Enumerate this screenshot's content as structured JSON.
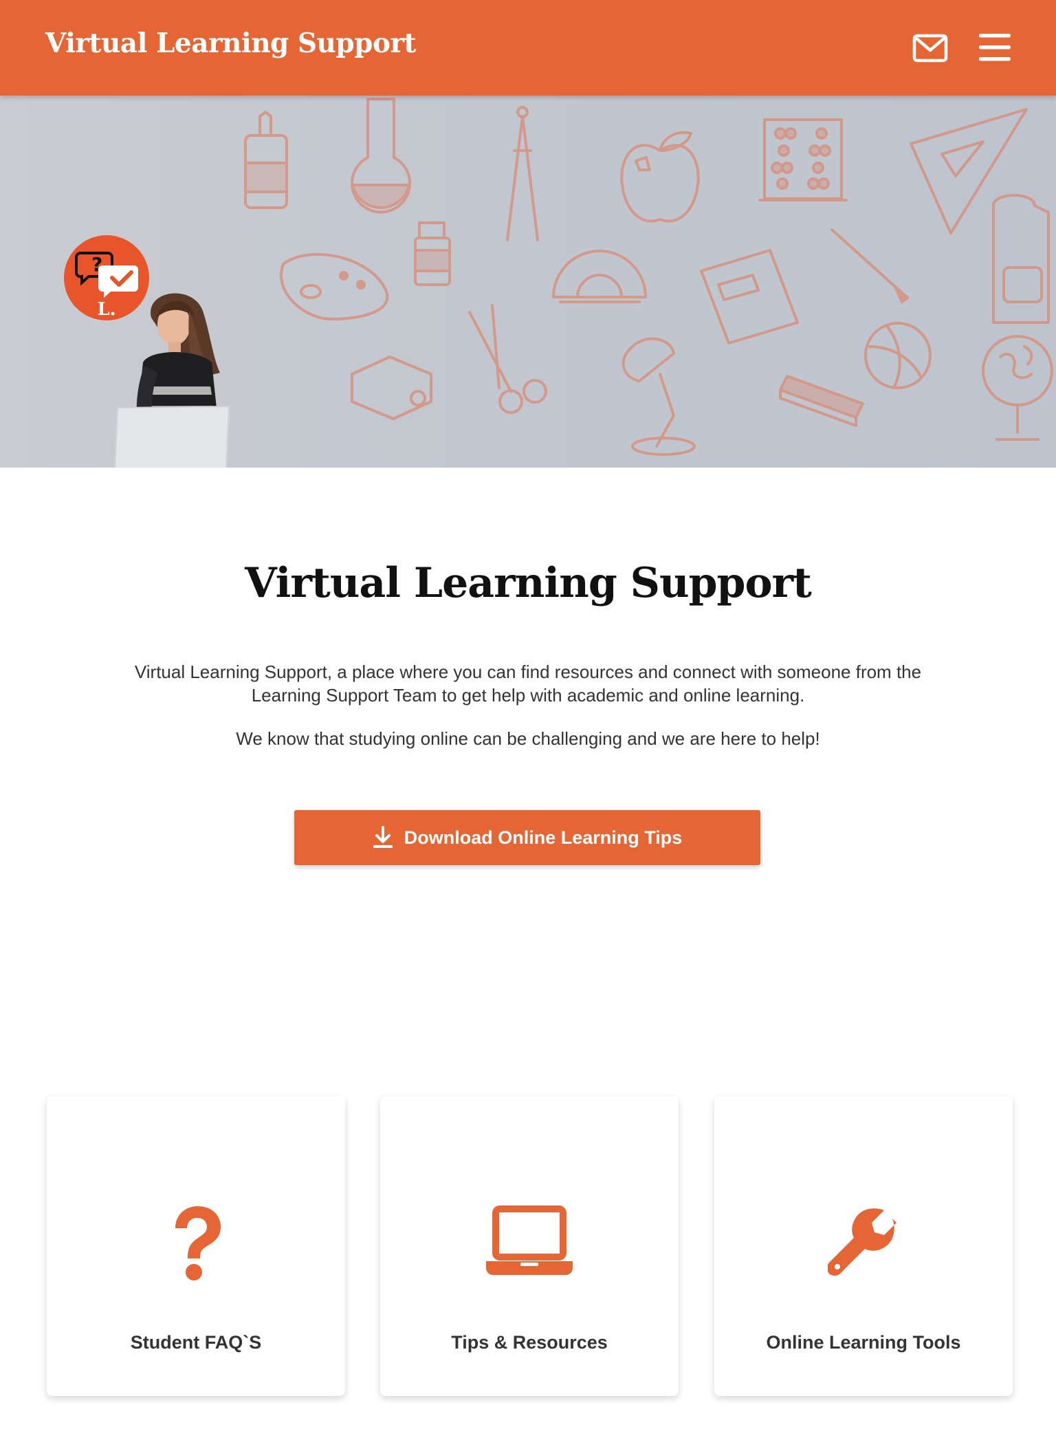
{
  "header": {
    "title": "Virtual Learning Support",
    "mail_icon": "mail-icon",
    "menu_icon": "hamburger-menu-icon",
    "bg_color": "#e66535"
  },
  "hero": {
    "logo_letter": "L.",
    "logo_icon": "question-check-chat-icon",
    "doodle_color": "#d98a73"
  },
  "intro": {
    "title": "Virtual Learning Support",
    "paragraph1": "Virtual Learning Support, a place where you can find resources and connect with someone from the Learning Support Team to get help with academic and online learning.",
    "paragraph2": "We know that studying online can be challenging and we are here to help!",
    "download_button": {
      "label": "Download Online Learning Tips",
      "icon": "download-icon"
    }
  },
  "cards": [
    {
      "label": "Student FAQ`S",
      "icon": "question-mark-icon"
    },
    {
      "label": "Tips & Resources",
      "icon": "laptop-icon"
    },
    {
      "label": "Online Learning Tools",
      "icon": "wrench-icon"
    }
  ],
  "colors": {
    "accent": "#e66535",
    "text": "#333333",
    "hero_bg": "#c4c9d0"
  }
}
